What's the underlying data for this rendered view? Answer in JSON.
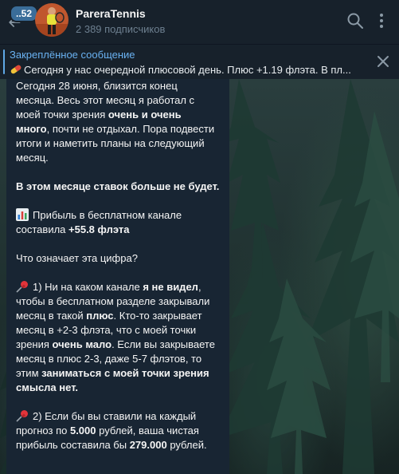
{
  "header": {
    "unread_count": "..52",
    "channel_name": "PareraTennis",
    "subscribers": "2 389 подписчиков"
  },
  "pinned": {
    "title": "Закреплённое сообщение",
    "text": "Сегодня у нас очередной плюсовой день. Плюс +1.19 флэта.  В пл..."
  },
  "message": {
    "p1": {
      "l1": "Сегодня 28 июня, близится конец",
      "l2": "месяца. Весь этот месяц я работал с",
      "l3a": "моей точки зрения ",
      "l3b": "очень и очень",
      "l4a": "много",
      "l4b": ", почти не отдыхал. Пора подвести",
      "l5": "итоги и наметить планы на следующий",
      "l6": "месяц."
    },
    "p2": "В этом месяце ставок больше не будет.",
    "p3": {
      "l1": "Прибыль в бесплатном канале",
      "l2a": "составила ",
      "l2b": "+55.8 флэта"
    },
    "p4": "Что означает эта цифра?",
    "p5": {
      "l1a": "1) Ни на каком канале ",
      "l1b": "я не видел",
      "l1c": ",",
      "l2": "чтобы в бесплатном разделе закрывали",
      "l3a": "месяц в такой ",
      "l3b": "плюс",
      "l3c": ". Кто-то закрывает",
      "l4": "месяц в +2-3 флэта, что с моей точки",
      "l5a": "зрения ",
      "l5b": "очень мало",
      "l5c": ". Если вы закрываете",
      "l6": "месяц в плюс 2-3, даже 5-7 флэтов, то",
      "l7a": "этим ",
      "l7b": "заниматься с моей точки зрения",
      "l8": "смысла нет."
    },
    "p6": {
      "l1": "2) Если бы вы ставили на каждый",
      "l2a": "прогноз по ",
      "l2b": "5.000",
      "l2c": " рублей, ваша чистая",
      "l3a": "прибыль составила бы ",
      "l3b": "279.000",
      "l3c": " рублей."
    }
  },
  "icons": {
    "back": "arrow-left-icon",
    "search": "search-icon",
    "menu": "vertical-dots-icon",
    "close": "close-icon",
    "pin_emoji": "pushpin-emoji-icon",
    "chart_emoji": "bar-chart-emoji-icon",
    "pinned_emoji": "pill-emoji-icon"
  },
  "colors": {
    "header_bg": "#17212b",
    "bubble_bg": "#182533",
    "accent": "#6ab2f2",
    "text": "#f5f5f5",
    "muted": "#6d7f8f"
  }
}
